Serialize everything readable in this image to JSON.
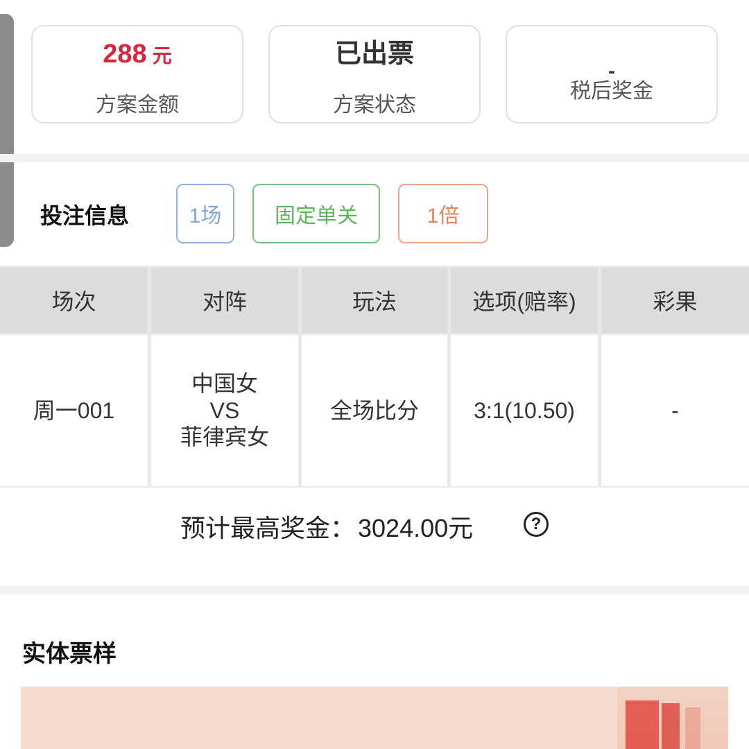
{
  "summary": {
    "amount_value": "288",
    "amount_unit": "元",
    "amount_label": "方案金额",
    "status_value": "已出票",
    "status_label": "方案状态",
    "prize_value": "-",
    "prize_label": "税后奖金"
  },
  "bet_info": {
    "title": "投注信息",
    "tags": [
      "1场",
      "固定单关",
      "1倍"
    ]
  },
  "table": {
    "headers": [
      "场次",
      "对阵",
      "玩法",
      "选项(赔率)",
      "彩果"
    ],
    "row": {
      "match_no": "周一001",
      "home": "中国女",
      "vs": "VS",
      "away": "菲律宾女",
      "play": "全场比分",
      "option": "3:1(10.50)",
      "result": "-"
    }
  },
  "max_prize": {
    "label": "预计最高奖金：",
    "amount": "3024.00元"
  },
  "sample": {
    "title": "实体票样"
  },
  "colors": {
    "accent_red": "#d7263d",
    "tag_blue": "#8db3e2",
    "tag_green": "#76c576",
    "tag_orange": "#e9a58a"
  }
}
